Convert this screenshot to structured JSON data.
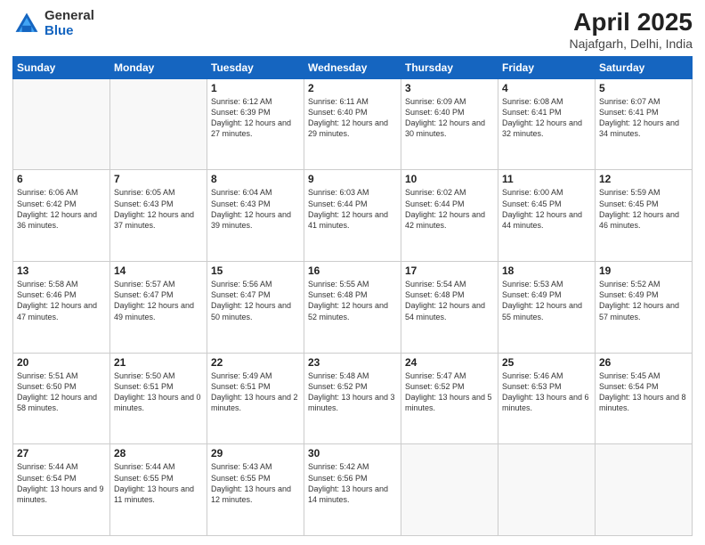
{
  "logo": {
    "general": "General",
    "blue": "Blue"
  },
  "title": {
    "month": "April 2025",
    "location": "Najafgarh, Delhi, India"
  },
  "weekdays": [
    "Sunday",
    "Monday",
    "Tuesday",
    "Wednesday",
    "Thursday",
    "Friday",
    "Saturday"
  ],
  "weeks": [
    [
      {
        "day": "",
        "info": ""
      },
      {
        "day": "",
        "info": ""
      },
      {
        "day": "1",
        "info": "Sunrise: 6:12 AM\nSunset: 6:39 PM\nDaylight: 12 hours\nand 27 minutes."
      },
      {
        "day": "2",
        "info": "Sunrise: 6:11 AM\nSunset: 6:40 PM\nDaylight: 12 hours\nand 29 minutes."
      },
      {
        "day": "3",
        "info": "Sunrise: 6:09 AM\nSunset: 6:40 PM\nDaylight: 12 hours\nand 30 minutes."
      },
      {
        "day": "4",
        "info": "Sunrise: 6:08 AM\nSunset: 6:41 PM\nDaylight: 12 hours\nand 32 minutes."
      },
      {
        "day": "5",
        "info": "Sunrise: 6:07 AM\nSunset: 6:41 PM\nDaylight: 12 hours\nand 34 minutes."
      }
    ],
    [
      {
        "day": "6",
        "info": "Sunrise: 6:06 AM\nSunset: 6:42 PM\nDaylight: 12 hours\nand 36 minutes."
      },
      {
        "day": "7",
        "info": "Sunrise: 6:05 AM\nSunset: 6:43 PM\nDaylight: 12 hours\nand 37 minutes."
      },
      {
        "day": "8",
        "info": "Sunrise: 6:04 AM\nSunset: 6:43 PM\nDaylight: 12 hours\nand 39 minutes."
      },
      {
        "day": "9",
        "info": "Sunrise: 6:03 AM\nSunset: 6:44 PM\nDaylight: 12 hours\nand 41 minutes."
      },
      {
        "day": "10",
        "info": "Sunrise: 6:02 AM\nSunset: 6:44 PM\nDaylight: 12 hours\nand 42 minutes."
      },
      {
        "day": "11",
        "info": "Sunrise: 6:00 AM\nSunset: 6:45 PM\nDaylight: 12 hours\nand 44 minutes."
      },
      {
        "day": "12",
        "info": "Sunrise: 5:59 AM\nSunset: 6:45 PM\nDaylight: 12 hours\nand 46 minutes."
      }
    ],
    [
      {
        "day": "13",
        "info": "Sunrise: 5:58 AM\nSunset: 6:46 PM\nDaylight: 12 hours\nand 47 minutes."
      },
      {
        "day": "14",
        "info": "Sunrise: 5:57 AM\nSunset: 6:47 PM\nDaylight: 12 hours\nand 49 minutes."
      },
      {
        "day": "15",
        "info": "Sunrise: 5:56 AM\nSunset: 6:47 PM\nDaylight: 12 hours\nand 50 minutes."
      },
      {
        "day": "16",
        "info": "Sunrise: 5:55 AM\nSunset: 6:48 PM\nDaylight: 12 hours\nand 52 minutes."
      },
      {
        "day": "17",
        "info": "Sunrise: 5:54 AM\nSunset: 6:48 PM\nDaylight: 12 hours\nand 54 minutes."
      },
      {
        "day": "18",
        "info": "Sunrise: 5:53 AM\nSunset: 6:49 PM\nDaylight: 12 hours\nand 55 minutes."
      },
      {
        "day": "19",
        "info": "Sunrise: 5:52 AM\nSunset: 6:49 PM\nDaylight: 12 hours\nand 57 minutes."
      }
    ],
    [
      {
        "day": "20",
        "info": "Sunrise: 5:51 AM\nSunset: 6:50 PM\nDaylight: 12 hours\nand 58 minutes."
      },
      {
        "day": "21",
        "info": "Sunrise: 5:50 AM\nSunset: 6:51 PM\nDaylight: 13 hours\nand 0 minutes."
      },
      {
        "day": "22",
        "info": "Sunrise: 5:49 AM\nSunset: 6:51 PM\nDaylight: 13 hours\nand 2 minutes."
      },
      {
        "day": "23",
        "info": "Sunrise: 5:48 AM\nSunset: 6:52 PM\nDaylight: 13 hours\nand 3 minutes."
      },
      {
        "day": "24",
        "info": "Sunrise: 5:47 AM\nSunset: 6:52 PM\nDaylight: 13 hours\nand 5 minutes."
      },
      {
        "day": "25",
        "info": "Sunrise: 5:46 AM\nSunset: 6:53 PM\nDaylight: 13 hours\nand 6 minutes."
      },
      {
        "day": "26",
        "info": "Sunrise: 5:45 AM\nSunset: 6:54 PM\nDaylight: 13 hours\nand 8 minutes."
      }
    ],
    [
      {
        "day": "27",
        "info": "Sunrise: 5:44 AM\nSunset: 6:54 PM\nDaylight: 13 hours\nand 9 minutes."
      },
      {
        "day": "28",
        "info": "Sunrise: 5:44 AM\nSunset: 6:55 PM\nDaylight: 13 hours\nand 11 minutes."
      },
      {
        "day": "29",
        "info": "Sunrise: 5:43 AM\nSunset: 6:55 PM\nDaylight: 13 hours\nand 12 minutes."
      },
      {
        "day": "30",
        "info": "Sunrise: 5:42 AM\nSunset: 6:56 PM\nDaylight: 13 hours\nand 14 minutes."
      },
      {
        "day": "",
        "info": ""
      },
      {
        "day": "",
        "info": ""
      },
      {
        "day": "",
        "info": ""
      }
    ]
  ]
}
